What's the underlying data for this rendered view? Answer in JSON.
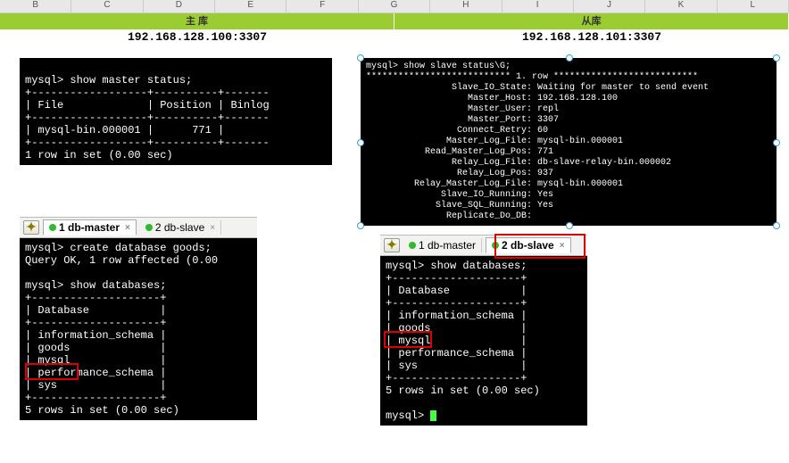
{
  "columns": [
    "B",
    "C",
    "D",
    "E",
    "F",
    "G",
    "H",
    "I",
    "J",
    "K",
    "L"
  ],
  "header": {
    "left": "主 库",
    "right": "从库"
  },
  "ip": {
    "left": "192.168.128.100:3307",
    "right": "192.168.128.101:3307"
  },
  "master_status": {
    "prompt_cmd": "mysql> show master status;",
    "cols": [
      "File",
      "Position",
      "Binlog"
    ],
    "row": [
      "mysql-bin.000001",
      "771",
      ""
    ],
    "footer": "1 row in set (0.00 sec)"
  },
  "slave_status": {
    "prompt_cmd": "mysql> show slave status\\G;",
    "row_marker": "*************************** 1. row ***************************",
    "fields": [
      [
        "Slave_IO_State",
        "Waiting for master to send event"
      ],
      [
        "Master_Host",
        "192.168.128.100"
      ],
      [
        "Master_User",
        "repl"
      ],
      [
        "Master_Port",
        "3307"
      ],
      [
        "Connect_Retry",
        "60"
      ],
      [
        "Master_Log_File",
        "mysql-bin.000001"
      ],
      [
        "Read_Master_Log_Pos",
        "771"
      ],
      [
        "Relay_Log_File",
        "db-slave-relay-bin.000002"
      ],
      [
        "Relay_Log_Pos",
        "937"
      ],
      [
        "Relay_Master_Log_File",
        "mysql-bin.000001"
      ],
      [
        "Slave_IO_Running",
        "Yes"
      ],
      [
        "Slave_SQL_Running",
        "Yes"
      ],
      [
        "Replicate_Do_DB",
        ""
      ]
    ]
  },
  "master_db": {
    "tabs": [
      "1 db-master",
      "2 db-slave"
    ],
    "create_cmd": "mysql> create database goods;",
    "create_res": "Query OK, 1 row affected (0.00",
    "show_cmd": "mysql> show databases;",
    "db_header": "Database",
    "dbs": [
      "information_schema",
      "goods",
      "mysql",
      "performance_schema",
      "sys"
    ],
    "footer": "5 rows in set (0.00 sec)"
  },
  "slave_db": {
    "tabs": [
      "1 db-master",
      "2 db-slave"
    ],
    "show_cmd": "mysql> show databases;",
    "db_header": "Database",
    "dbs": [
      "information_schema",
      "goods",
      "mysql",
      "performance_schema",
      "sys"
    ],
    "footer": "5 rows in set (0.00 sec)",
    "prompt": "mysql> "
  }
}
